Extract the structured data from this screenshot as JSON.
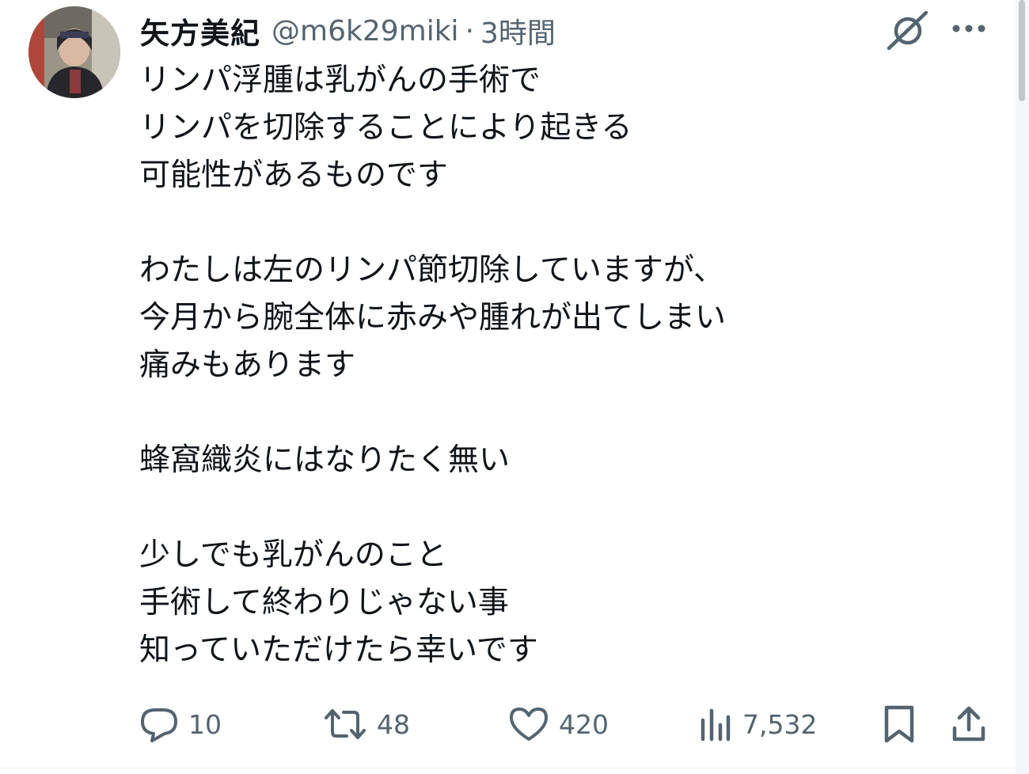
{
  "tweet": {
    "display_name": "矢方美紀",
    "handle": "@m6k29miki",
    "separator": "·",
    "timestamp": "3時間",
    "lines": [
      "リンパ浮腫は乳がんの手術で",
      "リンパを切除することにより起きる",
      "可能性があるものです",
      "",
      "わたしは左のリンパ節切除していますが、",
      "今月から腕全体に赤みや腫れが出てしまい",
      "痛みもあります",
      "",
      "蜂窩織炎にはなりたく無い",
      "",
      "少しでも乳がんのこと",
      "手術して終わりじゃない事",
      "知っていただけたら幸いです"
    ]
  },
  "actions": {
    "reply_count": "10",
    "retweet_count": "48",
    "like_count": "420",
    "views_count": "7,532"
  },
  "icons": {
    "grok": "grok-icon",
    "more": "more-icon",
    "reply": "reply-icon",
    "retweet": "retweet-icon",
    "like": "heart-icon",
    "views": "views-icon",
    "bookmark": "bookmark-icon",
    "share": "share-icon"
  },
  "colors": {
    "text_primary": "#0f1419",
    "text_secondary": "#536471"
  }
}
